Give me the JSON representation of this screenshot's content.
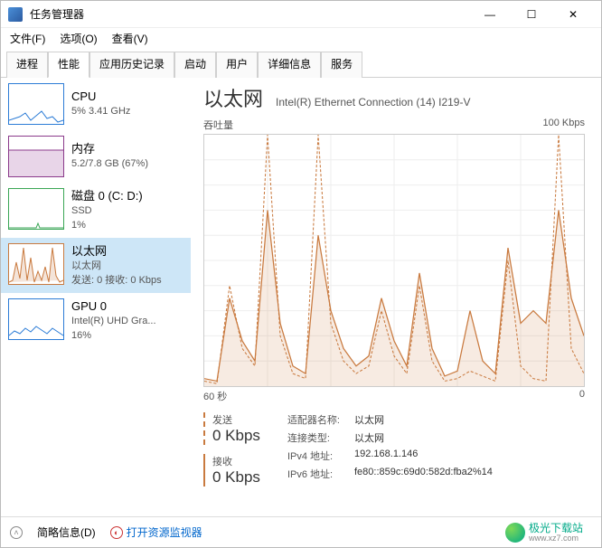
{
  "window": {
    "title": "任务管理器",
    "min": "—",
    "max": "☐",
    "close": "✕"
  },
  "menu": {
    "file": "文件(F)",
    "options": "选项(O)",
    "view": "查看(V)"
  },
  "tabs": [
    "进程",
    "性能",
    "应用历史记录",
    "启动",
    "用户",
    "详细信息",
    "服务"
  ],
  "sidebar": [
    {
      "label": "CPU",
      "line1": "5% 3.41 GHz",
      "line2": "",
      "color": "#2c7cd6"
    },
    {
      "label": "内存",
      "line1": "5.2/7.8 GB (67%)",
      "line2": "",
      "color": "#8b3a8b"
    },
    {
      "label": "磁盘 0 (C: D:)",
      "line1": "SSD",
      "line2": "1%",
      "color": "#3aa655"
    },
    {
      "label": "以太网",
      "line1": "以太网",
      "line2": "发送: 0 接收: 0 Kbps",
      "color": "#c97a3f"
    },
    {
      "label": "GPU 0",
      "line1": "Intel(R) UHD Gra...",
      "line2": "16%",
      "color": "#2c7cd6"
    }
  ],
  "main": {
    "title": "以太网",
    "adapter": "Intel(R) Ethernet Connection (14) I219-V",
    "chart_top_left": "吞吐量",
    "chart_top_right": "100 Kbps",
    "xaxis_left": "60 秒",
    "xaxis_right": "0",
    "send_label": "发送",
    "send_value": "0 Kbps",
    "recv_label": "接收",
    "recv_value": "0 Kbps",
    "props": [
      {
        "k": "适配器名称:",
        "v": "以太网"
      },
      {
        "k": "连接类型:",
        "v": "以太网"
      },
      {
        "k": "IPv4 地址:",
        "v": "192.168.1.146"
      },
      {
        "k": "IPv6 地址:",
        "v": "fe80::859c:69d0:582d:fba2%14"
      }
    ]
  },
  "footer": {
    "brief": "简略信息(D)",
    "resmon": "打开资源监视器"
  },
  "watermark": {
    "brand": "极光下载站",
    "url": "www.xz7.com"
  },
  "chart_data": {
    "type": "line",
    "title": "吞吐量",
    "xlabel": "60 秒 → 0",
    "ylabel": "Kbps",
    "ylim": [
      0,
      100
    ],
    "x": [
      60,
      58,
      56,
      54,
      52,
      50,
      48,
      46,
      44,
      42,
      40,
      38,
      36,
      34,
      32,
      30,
      28,
      26,
      24,
      22,
      20,
      18,
      16,
      14,
      12,
      10,
      8,
      6,
      4,
      2,
      0
    ],
    "series": [
      {
        "name": "发送",
        "values": [
          2,
          1,
          40,
          15,
          8,
          100,
          20,
          5,
          3,
          100,
          25,
          10,
          5,
          8,
          30,
          12,
          5,
          40,
          10,
          2,
          3,
          6,
          4,
          2,
          50,
          8,
          3,
          2,
          100,
          15,
          5
        ]
      },
      {
        "name": "接收",
        "values": [
          3,
          2,
          35,
          18,
          10,
          70,
          25,
          8,
          5,
          60,
          30,
          15,
          8,
          12,
          35,
          18,
          8,
          45,
          15,
          4,
          6,
          30,
          10,
          5,
          55,
          25,
          30,
          25,
          70,
          35,
          20
        ]
      }
    ]
  }
}
